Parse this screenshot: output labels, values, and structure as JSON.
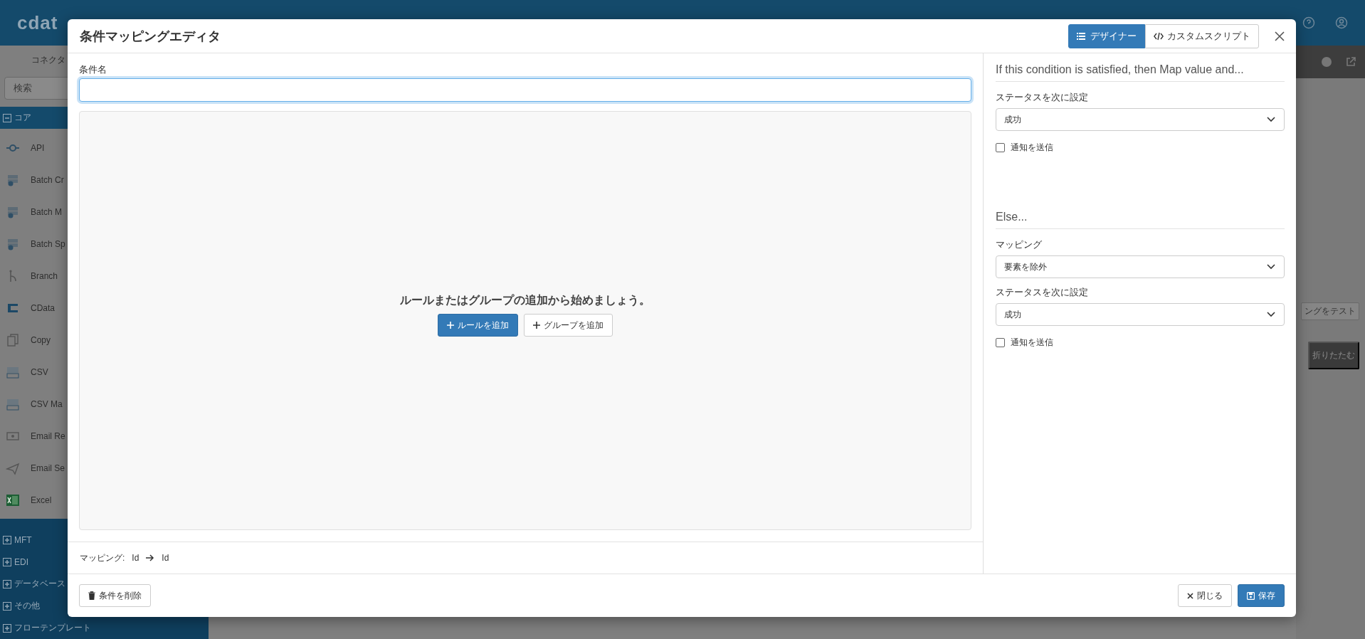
{
  "app": {
    "logo": "cdat",
    "sidebar": {
      "title": "コネクタ",
      "search_placeholder": "検索",
      "groups": [
        {
          "label": "コア",
          "expanded": true,
          "items": [
            {
              "label": "API",
              "kind": "connector"
            },
            {
              "label": "Batch Cr",
              "kind": "batch"
            },
            {
              "label": "Batch M",
              "kind": "batch"
            },
            {
              "label": "Batch Sp",
              "kind": "batch"
            },
            {
              "label": "Branch",
              "kind": "branch"
            },
            {
              "label": "CData",
              "kind": "cdata"
            },
            {
              "label": "Copy",
              "kind": "copy"
            },
            {
              "label": "CSV",
              "kind": "csv"
            },
            {
              "label": "CSV Ma",
              "kind": "csv"
            },
            {
              "label": "Email Re",
              "kind": "mail"
            },
            {
              "label": "Email Se",
              "kind": "send"
            },
            {
              "label": "Excel",
              "kind": "excel"
            }
          ]
        },
        {
          "label": "MFT",
          "expanded": false
        },
        {
          "label": "EDI",
          "expanded": false
        },
        {
          "label": "データベース",
          "expanded": false
        },
        {
          "label": "その他",
          "expanded": false
        },
        {
          "label": "フローテンプレート",
          "expanded": false
        }
      ]
    },
    "panel_buttons": [
      {
        "label": "ングをテスト",
        "kind": "outline"
      },
      {
        "label": "折りたたむ",
        "kind": "dark"
      }
    ]
  },
  "dialog": {
    "title": "条件マッピングエディタ",
    "tabs": [
      {
        "label": "デザイナー",
        "kind": "list",
        "selected": true
      },
      {
        "label": "カスタムスクリプト",
        "kind": "code",
        "selected": false
      }
    ],
    "condition_name": {
      "label": "条件名",
      "focused": true
    },
    "rules": {
      "empty_message": "ルールまたはグループの追加から始めましょう。",
      "buttons": [
        {
          "label": "ルールを追加",
          "primary": true
        },
        {
          "label": "グループを追加",
          "primary": false
        }
      ]
    },
    "mapping": {
      "label": "マッピング:",
      "source": "Id",
      "target": "Id"
    },
    "then": {
      "heading": "If this condition is satisfied, then Map value and...",
      "fields": [
        {
          "kind": "select",
          "label": "ステータスを次に設定",
          "value": "成功"
        },
        {
          "kind": "checkbox",
          "label": "通知を送信",
          "checked": false
        }
      ]
    },
    "else": {
      "heading": "Else...",
      "fields": [
        {
          "kind": "select",
          "label": "マッピング",
          "value": "要素を除外"
        },
        {
          "kind": "select",
          "label": "ステータスを次に設定",
          "value": "成功"
        },
        {
          "kind": "checkbox",
          "label": "通知を送信",
          "checked": false
        }
      ]
    },
    "footer": {
      "delete": "条件を削除",
      "close": "閉じる",
      "save": "保存"
    }
  }
}
